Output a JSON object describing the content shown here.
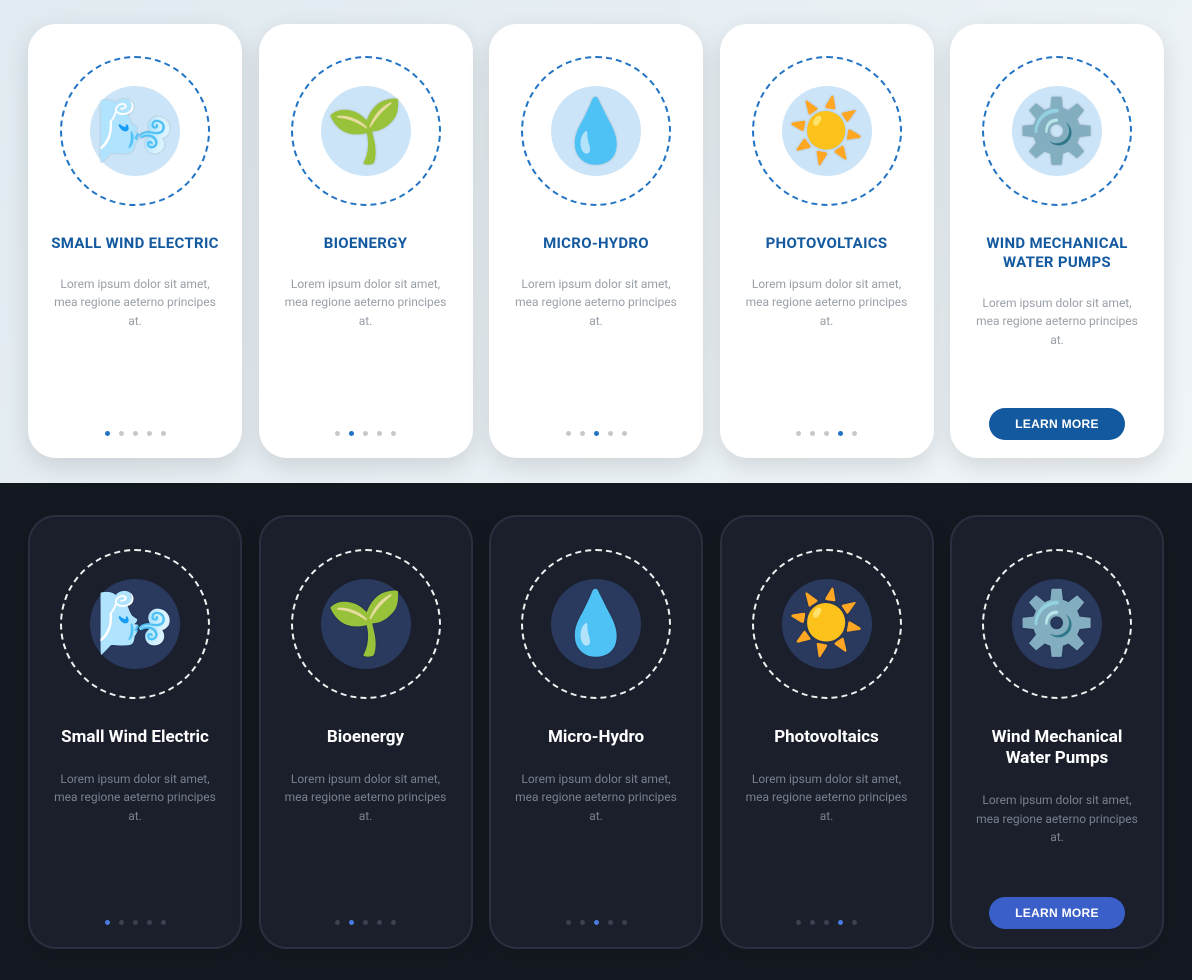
{
  "lorem": "Lorem ipsum dolor sit amet, mea regione aeterno principes at.",
  "cta_label": "LEARN MORE",
  "light": {
    "cards": [
      {
        "title": "SMALL WIND ELECTRIC",
        "icon": "wind-electric-icon",
        "glyph": "🌬️",
        "active": 0
      },
      {
        "title": "BIOENERGY",
        "icon": "bioenergy-icon",
        "glyph": "🌱",
        "active": 1
      },
      {
        "title": "MICRO-HYDRO",
        "icon": "micro-hydro-icon",
        "glyph": "💧",
        "active": 2
      },
      {
        "title": "PHOTOVOLTAICS",
        "icon": "photovoltaics-icon",
        "glyph": "☀️",
        "active": 3
      },
      {
        "title": "WIND MECHANICAL WATER PUMPS",
        "icon": "wind-pump-icon",
        "glyph": "⚙️",
        "active": 4
      }
    ]
  },
  "dark": {
    "cards": [
      {
        "title": "Small Wind Electric",
        "icon": "wind-electric-icon",
        "glyph": "🌬️",
        "active": 0
      },
      {
        "title": "Bioenergy",
        "icon": "bioenergy-icon",
        "glyph": "🌱",
        "active": 1
      },
      {
        "title": "Micro-Hydro",
        "icon": "micro-hydro-icon",
        "glyph": "💧",
        "active": 2
      },
      {
        "title": "Photovoltaics",
        "icon": "photovoltaics-icon",
        "glyph": "☀️",
        "active": 3
      },
      {
        "title": "Wind Mechanical Water Pumps",
        "icon": "wind-pump-icon",
        "glyph": "⚙️",
        "active": 4
      }
    ]
  },
  "dot_count": 5
}
